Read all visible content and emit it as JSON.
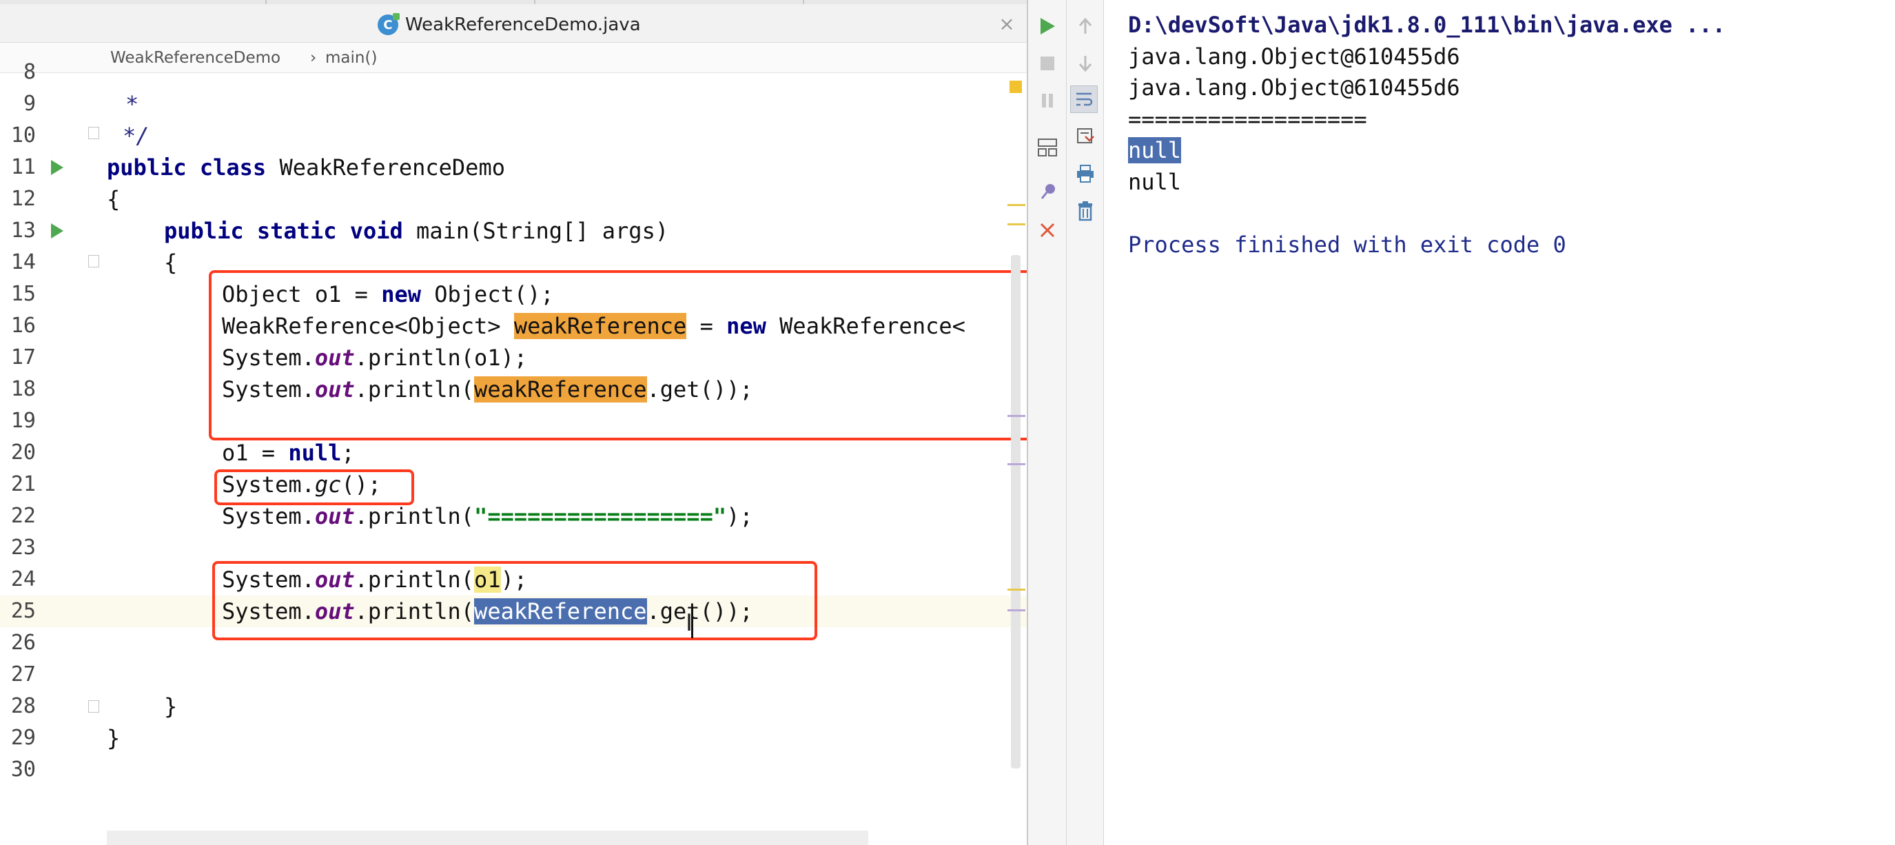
{
  "editor": {
    "tab_label": "WeakReferenceDemo.java",
    "close_glyph": "×",
    "breadcrumb": {
      "class_name": "WeakReferenceDemo",
      "separator": "›",
      "method_name": "main()"
    },
    "line_numbers": [
      "8",
      "9",
      "10",
      "11",
      "12",
      "13",
      "14",
      "15",
      "16",
      "17",
      "18",
      "19",
      "20",
      "21",
      "22",
      "23",
      "24",
      "25",
      "26",
      "27",
      "28",
      "29",
      "30"
    ],
    "lines": {
      "l9_star": "*",
      "l10_end": "*/",
      "l11_kw": "public class",
      "l11_name": "WeakReferenceDemo",
      "l12": "{",
      "l13_kw": "public static void",
      "l13_rest": "main(String[] args)",
      "l14": "{",
      "l15_a": "Object o1 = ",
      "l15_kw": "new",
      "l15_b": " Object();",
      "l16_a": "WeakReference<Object> ",
      "l16_var": "weakReference",
      "l16_b": " = ",
      "l16_kw": "new",
      "l16_c": " WeakReference<",
      "l17_a": "System.",
      "l17_out": "out",
      "l17_b": ".println(o1);",
      "l18_a": "System.",
      "l18_out": "out",
      "l18_b": ".println(",
      "l18_var": "weakReference",
      "l18_c": ".get());",
      "l20_a": "o1 = ",
      "l20_kw": "null",
      "l20_b": ";",
      "l21_a": "System.",
      "l21_gc": "gc",
      "l21_b": "();",
      "l22_a": "System.",
      "l22_out": "out",
      "l22_b": ".println(",
      "l22_str": "\"=================\"",
      "l22_c": ");",
      "l24_a": "System.",
      "l24_out": "out",
      "l24_b": ".println(",
      "l24_var": "o1",
      "l24_c": ");",
      "l25_a": "System.",
      "l25_out": "out",
      "l25_b": ".println(",
      "l25_var": "weakReference",
      "l25_c": ".get());",
      "l28": "}",
      "l29": "}"
    }
  },
  "run_panel": {
    "console": {
      "command": "D:\\devSoft\\Java\\jdk1.8.0_111\\bin\\java.exe ...",
      "output": [
        "java.lang.Object@610455d6",
        "java.lang.Object@610455d6",
        "=================="
      ],
      "selected_line": "null",
      "line_after": "null",
      "exit_message": "Process finished with exit code 0"
    },
    "icons": {
      "rerun": "rerun-icon",
      "stop": "stop-icon",
      "pause": "pause-icon",
      "layout": "layout-icon",
      "pin": "pin-icon",
      "close": "close-icon",
      "up": "up-arrow-icon",
      "down": "down-arrow-icon",
      "soft_wrap": "soft-wrap-icon",
      "scroll_to_end": "scroll-to-end-icon",
      "print": "print-icon",
      "clear": "trash-icon"
    }
  },
  "colors": {
    "annotation_red": "#ff3b1f",
    "highlight_orange": "#f0a43c",
    "selection_blue": "#4b6eaf",
    "run_green": "#4fa84f",
    "keyword_navy": "#000080",
    "field_purple": "#660e7a",
    "string_green": "#067d17"
  }
}
